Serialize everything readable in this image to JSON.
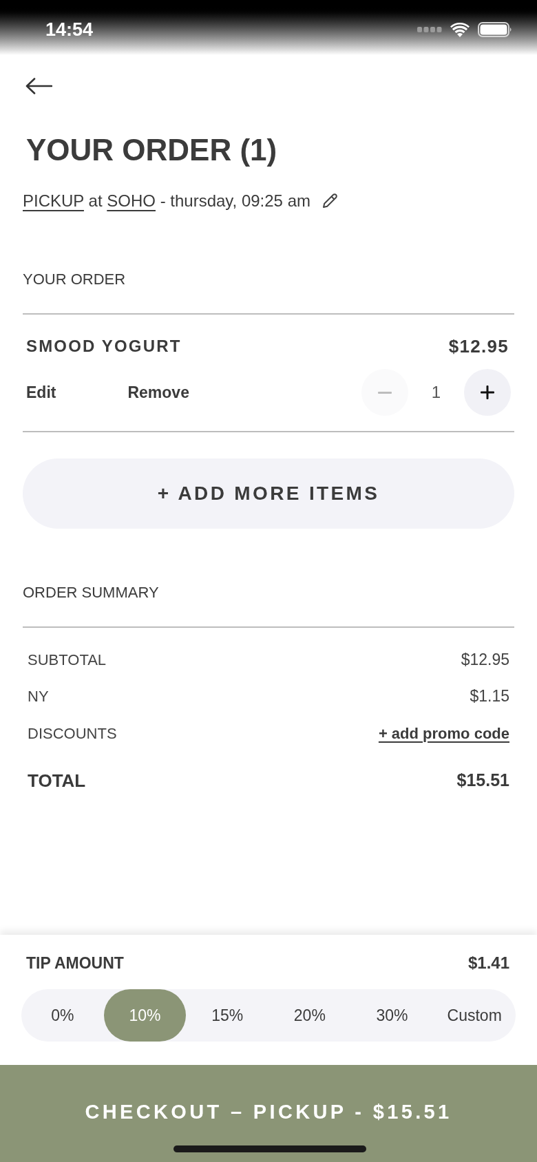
{
  "status_bar": {
    "time": "14:54"
  },
  "header": {
    "title": "YOUR ORDER (1)",
    "details": [
      {
        "kind": "link",
        "text": "PICKUP"
      },
      {
        "kind": "text",
        "text": "at"
      },
      {
        "kind": "link",
        "text": "SOHO"
      },
      {
        "kind": "text",
        "text": "- thursday, 09:25 am"
      }
    ]
  },
  "order": {
    "title": "YOUR ORDER",
    "items": [
      {
        "name": "SMOOD YOGURT",
        "price": "$12.95",
        "actions": [
          "Edit",
          "Remove"
        ],
        "quantity": "1",
        "decrease_disabled": true
      }
    ],
    "add_button": "+ ADD MORE ITEMS"
  },
  "summary": {
    "title": "ORDER SUMMARY",
    "rows": [
      {
        "kind": "line",
        "label": "SUBTOTAL",
        "value": "$12.95"
      },
      {
        "kind": "line",
        "label": "NY",
        "value": "$1.15"
      },
      {
        "kind": "promo",
        "label": "DISCOUNTS",
        "value": "+ add promo code"
      },
      {
        "kind": "total",
        "label": "TOTAL",
        "value": "$15.51"
      }
    ]
  },
  "tip": {
    "title": "TIP AMOUNT",
    "amount": "$1.41",
    "options": [
      {
        "label": "0%",
        "selected": false
      },
      {
        "label": "10%",
        "selected": true
      },
      {
        "label": "15%",
        "selected": false
      },
      {
        "label": "20%",
        "selected": false
      },
      {
        "label": "30%",
        "selected": false
      },
      {
        "label": "Custom",
        "selected": false
      }
    ]
  },
  "checkout_button": {
    "label": "CHECKOUT – PICKUP - $15.51"
  }
}
